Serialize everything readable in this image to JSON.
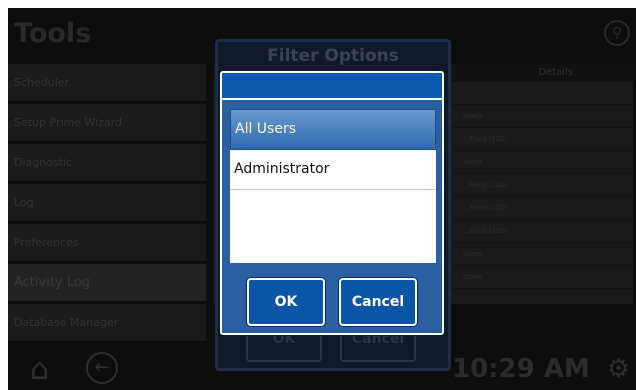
{
  "header": {
    "title": "Tools",
    "filter_icon": "filter-icon"
  },
  "sidebar": {
    "items": [
      {
        "label": "Scheduler"
      },
      {
        "label": "Setup Prime Wizard"
      },
      {
        "label": "Diagnostic"
      },
      {
        "label": "Log"
      },
      {
        "label": "Preferences"
      },
      {
        "label": "Activity Log"
      },
      {
        "label": "Database Manager"
      }
    ]
  },
  "table": {
    "header": "Details",
    "rows": [
      "...",
      "Users",
      "...Fluid (120)",
      "Users",
      "...Fluid (120)",
      "...Fluid (120)",
      "...Fluid (120)",
      "Users",
      "Users"
    ]
  },
  "background_dialog": {
    "title": "Filter Options",
    "ok_label": "OK",
    "cancel_label": "Cancel"
  },
  "dialog": {
    "list": [
      {
        "label": "All Users",
        "selected": true
      },
      {
        "label": "Administrator",
        "selected": false
      }
    ],
    "ok_label": "OK",
    "cancel_label": "Cancel"
  },
  "footer": {
    "time": "10:29 AM",
    "home_icon": "home-icon",
    "back_icon": "back-icon",
    "settings_icon": "gear-icon"
  },
  "colors": {
    "accent": "#0c5ab0",
    "selected_item": "#2f69ad",
    "background": "#0d0d0d"
  }
}
